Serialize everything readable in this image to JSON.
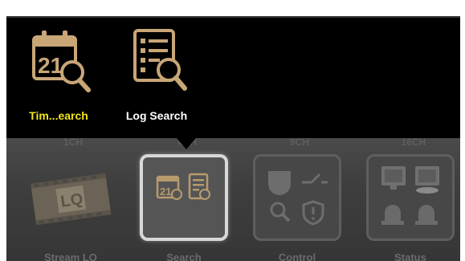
{
  "popup": {
    "items": [
      {
        "label": "Tim...earch",
        "icon": "calendar-search-icon",
        "color": "#f1e419"
      },
      {
        "label": "Log Search",
        "icon": "log-search-icon",
        "color": "#ffffff"
      }
    ]
  },
  "launcher": {
    "faded_headers": [
      "1CH",
      "4CH",
      "9CH",
      "16CH"
    ],
    "tiles": [
      {
        "label": "Stream LQ",
        "icon": "film-strip-icon"
      },
      {
        "label": "Search",
        "icon": "search-menu-icon",
        "selected": true
      },
      {
        "label": "Control",
        "icon": "control-menu-icon"
      },
      {
        "label": "Status",
        "icon": "status-menu-icon"
      }
    ]
  },
  "colors": {
    "gold_icon": "#c8a676",
    "highlight_label": "#f1e419",
    "selected_border": "#d8d8d8"
  }
}
